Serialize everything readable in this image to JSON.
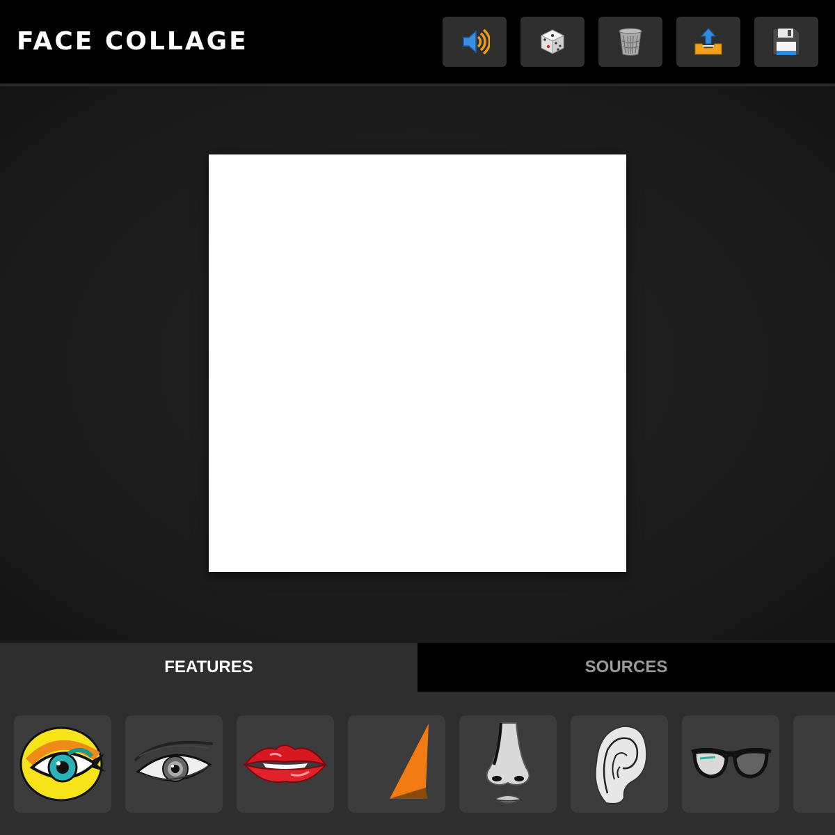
{
  "app": {
    "title": "FACE COLLAGE"
  },
  "toolbar": [
    {
      "name": "sound-button",
      "icon": "speaker-icon"
    },
    {
      "name": "randomize-button",
      "icon": "dice-icon"
    },
    {
      "name": "clear-button",
      "icon": "trash-icon"
    },
    {
      "name": "upload-button",
      "icon": "upload-tray-icon"
    },
    {
      "name": "save-button",
      "icon": "floppy-disk-icon"
    }
  ],
  "tabs": {
    "features": "FEATURES",
    "sources": "SOURCES",
    "active": "features"
  },
  "features": [
    {
      "name": "pop-art-eye",
      "icon": "pop-art-eye-icon"
    },
    {
      "name": "sketched-eye",
      "icon": "sketched-eye-icon"
    },
    {
      "name": "red-lips",
      "icon": "red-lips-icon"
    },
    {
      "name": "orange-shape",
      "icon": "orange-triangle-icon"
    },
    {
      "name": "nose",
      "icon": "nose-icon"
    },
    {
      "name": "ear",
      "icon": "ear-icon"
    },
    {
      "name": "glasses",
      "icon": "glasses-icon"
    },
    {
      "name": "more-item",
      "icon": "partial-item"
    }
  ],
  "colors": {
    "topbar": "#000000",
    "button_bg": "#2f2f2f",
    "workspace": "#1b1b1b",
    "canvas": "#ffffff",
    "tab_active": "#2e2e2e",
    "tab_inactive": "#000000",
    "item_bg": "#3c3c3c"
  }
}
